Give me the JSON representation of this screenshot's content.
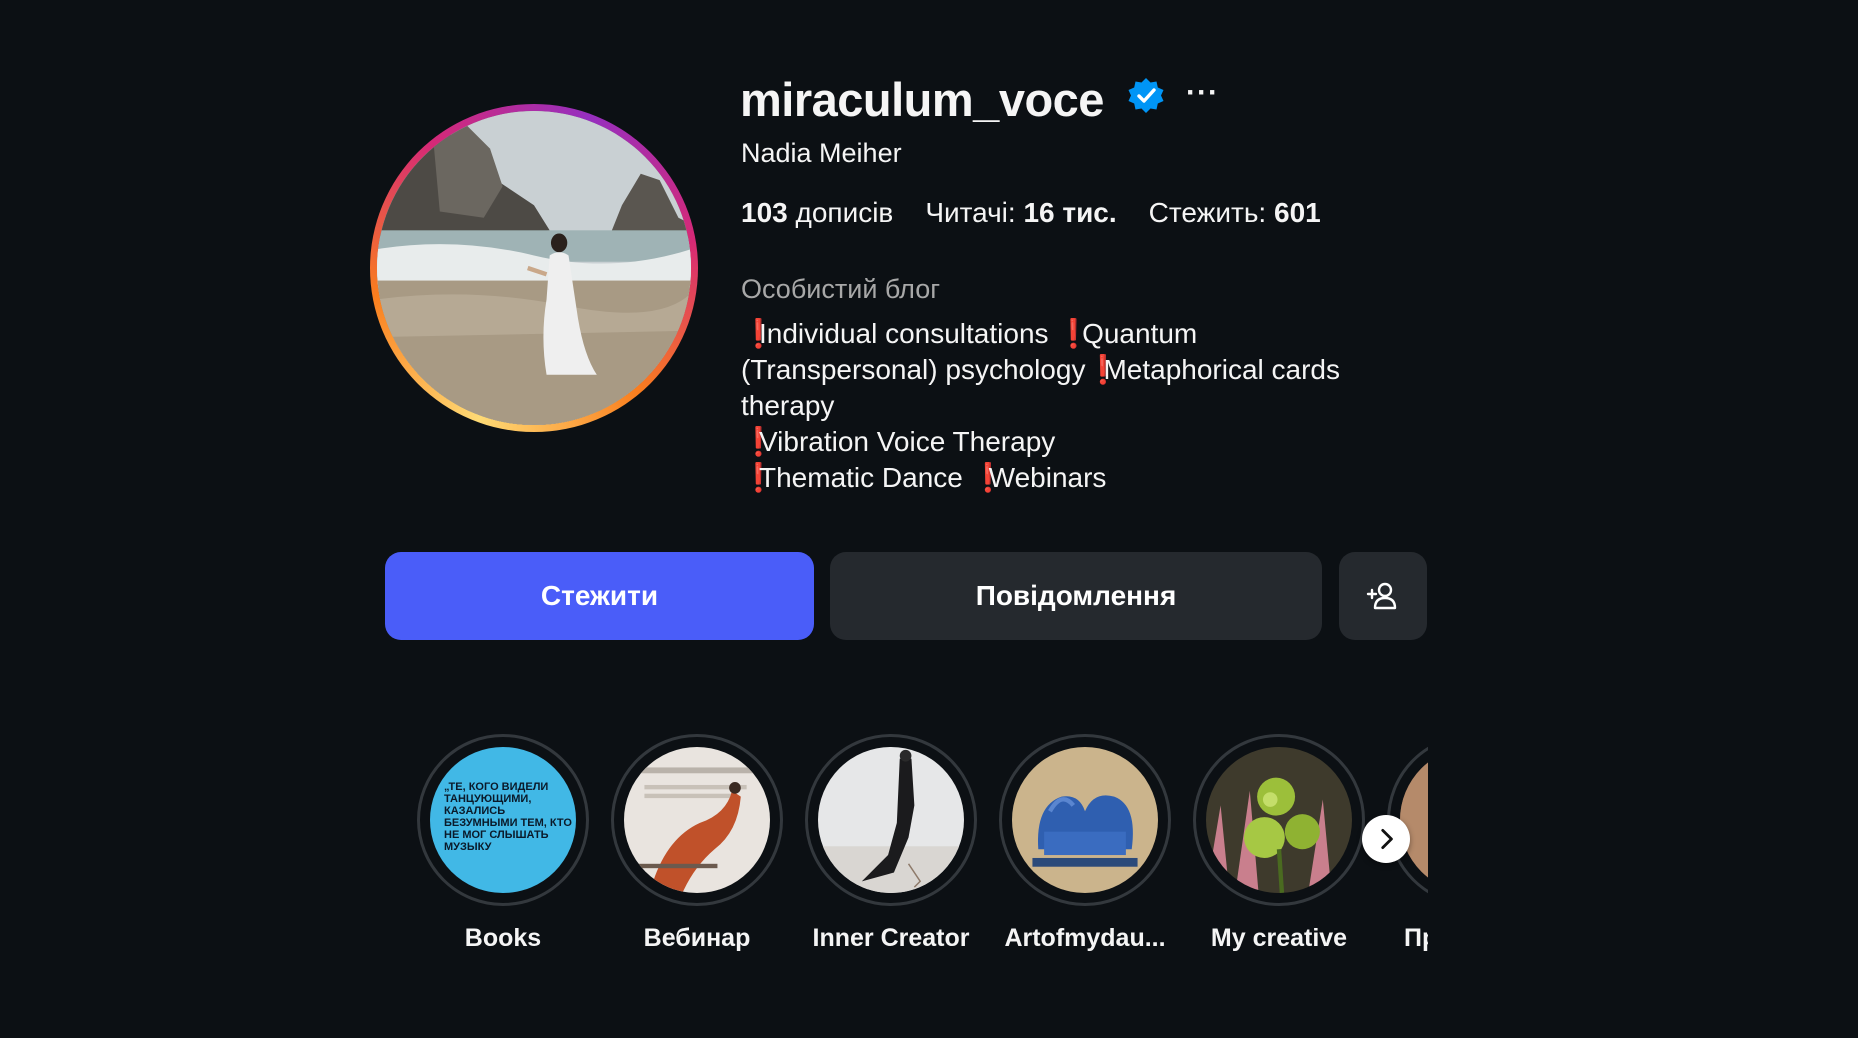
{
  "profile": {
    "username": "miraculum_voce",
    "full_name": "Nadia Meiher",
    "verified_icon": "verified-badge-icon",
    "more_label": "···",
    "stats": {
      "posts_count": "103",
      "posts_label": "дописів",
      "followers_label": "Читачі:",
      "followers_count": "16 тис.",
      "following_label": "Стежить:",
      "following_count": "601"
    },
    "category": "Особистий блог",
    "bio": {
      "mark": "❗",
      "item1": "Individual consultations",
      "item2a": "Quantum",
      "item2b": "(Transpersonal) psychology",
      "item3a": "Metaphorical cards",
      "item3b": "therapy",
      "item4": "Vibration Voice Therapy",
      "item5": "Thematic Dance",
      "item6": "Webinars"
    }
  },
  "actions": {
    "follow_label": "Стежити",
    "message_label": "Повідомлення",
    "add_user_icon": "person-add-icon"
  },
  "highlights": [
    {
      "label": "Books",
      "cover_text": "„ТЕ, КОГО ВИДЕЛИ ТАНЦУЮЩИМИ, КАЗАЛИСЬ БЕЗУМНЫМИ ТЕМ, КТО НЕ МОГ СЛЫШАТЬ МУЗЫКУ"
    },
    {
      "label": "Вебинар"
    },
    {
      "label": "Inner Creator"
    },
    {
      "label": "Artofmydau..."
    },
    {
      "label": "My creative"
    },
    {
      "label": "Пря"
    }
  ],
  "colors": {
    "background": "#0c1014",
    "follow_button": "#4a5df9",
    "secondary_button": "#25292e",
    "verified": "#0095f6",
    "bio_mark": "#e03a3a"
  }
}
